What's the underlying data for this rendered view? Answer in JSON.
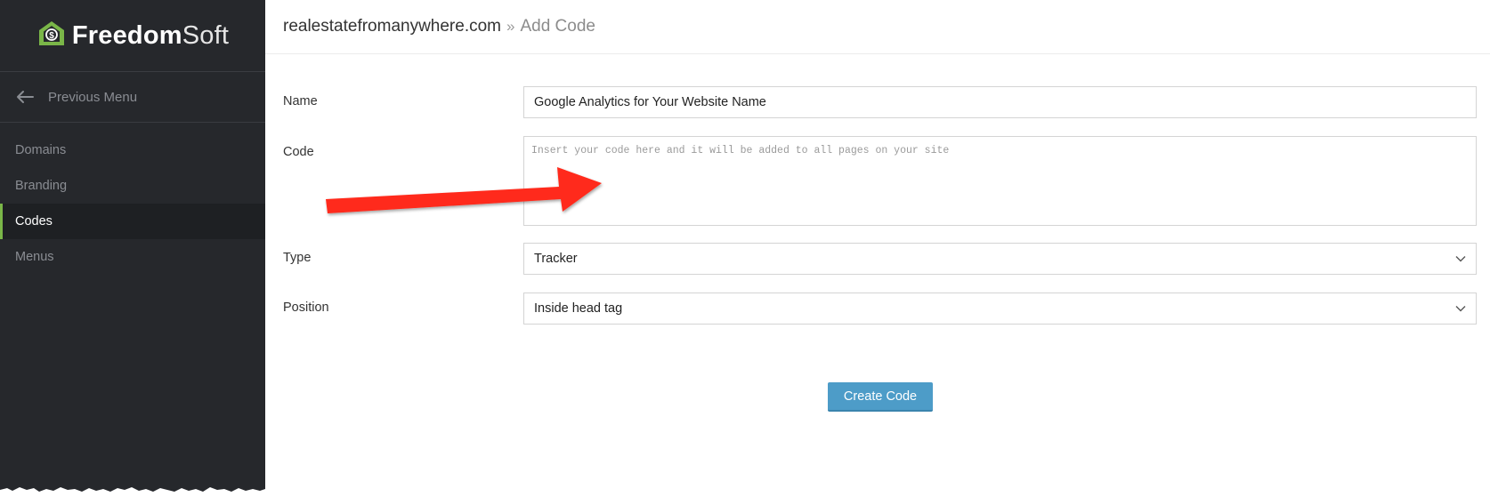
{
  "brand": {
    "name_bold": "Freedom",
    "name_light": "Soft"
  },
  "sidebar": {
    "previous_menu": "Previous Menu",
    "items": [
      {
        "label": "Domains",
        "active": false
      },
      {
        "label": "Branding",
        "active": false
      },
      {
        "label": "Codes",
        "active": true
      },
      {
        "label": "Menus",
        "active": false
      }
    ]
  },
  "breadcrumb": {
    "site": "realestatefromanywhere.com",
    "separator": "»",
    "page": "Add Code"
  },
  "form": {
    "name_label": "Name",
    "name_value": "Google Analytics for Your Website Name",
    "code_label": "Code",
    "code_placeholder": "Insert your code here and it will be added to all pages on your site",
    "type_label": "Type",
    "type_value": "Tracker",
    "position_label": "Position",
    "position_value": "Inside head tag",
    "submit_label": "Create Code"
  },
  "colors": {
    "sidebar_bg": "#26282c",
    "accent_green": "#7ab648",
    "button_blue": "#4d9cc8",
    "annotation_red": "#ff2a1a"
  },
  "icons": [
    "freedomsoft-logo-icon",
    "arrow-left-icon",
    "chevron-down-icon",
    "red-arrow-annotation"
  ]
}
